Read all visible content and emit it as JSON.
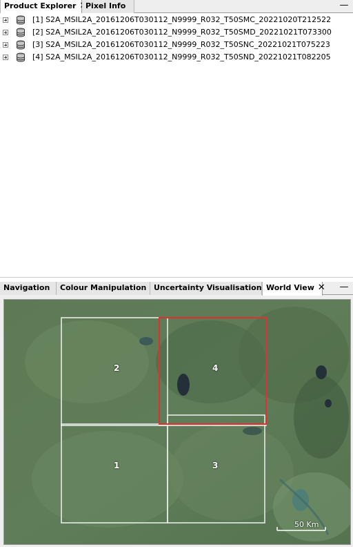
{
  "top_tabs": [
    {
      "label": "Product Explorer",
      "active": true,
      "closable": true
    },
    {
      "label": "Pixel Info",
      "active": false,
      "closable": false
    }
  ],
  "close_glyph": "✕",
  "minimize_glyph": "—",
  "products": [
    {
      "label": "[1] S2A_MSIL2A_20161206T030112_N9999_R032_T50SMC_20221020T212522",
      "icon": "database-icon"
    },
    {
      "label": "[2] S2A_MSIL2A_20161206T030112_N9999_R032_T50SMD_20221021T073300",
      "icon": "database-icon"
    },
    {
      "label": "[3] S2A_MSIL2A_20161206T030112_N9999_R032_T50SNC_20221021T075223",
      "icon": "database-icon"
    },
    {
      "label": "[4] S2A_MSIL2A_20161206T030112_N9999_R032_T50SND_20221021T082205",
      "icon": "database-icon"
    }
  ],
  "bottom_tabs": [
    {
      "label": "Navigation",
      "active": false
    },
    {
      "label": "Colour Manipulation",
      "active": false
    },
    {
      "label": "Uncertainty Visualisation",
      "active": false
    },
    {
      "label": "World View",
      "active": true,
      "closable": true
    }
  ],
  "world_view": {
    "tiles": [
      {
        "label": "1",
        "selected": false
      },
      {
        "label": "2",
        "selected": false
      },
      {
        "label": "3",
        "selected": false
      },
      {
        "label": "4",
        "selected": true
      }
    ],
    "scale_label": "50 Km",
    "selected_color": "#e03030",
    "tile_outline_color": "#f2f2f2"
  }
}
